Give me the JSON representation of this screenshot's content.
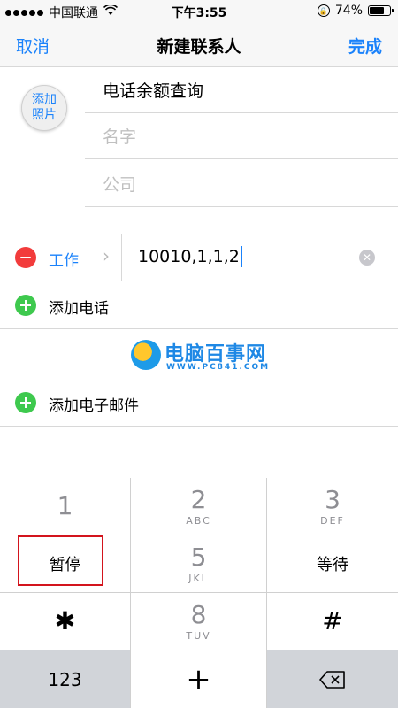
{
  "status_bar": {
    "carrier": "中国联通",
    "time": "下午3:55",
    "battery_percent": "74%",
    "battery_level": 0.74
  },
  "nav": {
    "cancel": "取消",
    "title": "新建联系人",
    "done": "完成"
  },
  "avatar": {
    "line1": "添加",
    "line2": "照片"
  },
  "fields": {
    "first": "电话余额查询",
    "name_placeholder": "名字",
    "company_placeholder": "公司"
  },
  "phone": {
    "label": "工作",
    "value": "10010,1,1,2"
  },
  "add_phone": "添加电话",
  "add_email": "添加电子邮件",
  "watermark": {
    "text": "电脑百事网",
    "url": "WWW.PC841.COM"
  },
  "keypad": {
    "k1": "1",
    "k2": "2",
    "k2_sub": "ABC",
    "k3": "3",
    "k3_sub": "DEF",
    "pause": "暂停",
    "k5": "5",
    "k5_sub": "JKL",
    "wait": "等待",
    "star": "✱",
    "k8": "8",
    "k8_sub": "TUV",
    "hash": "#",
    "k123": "123",
    "plus": "+"
  },
  "colors": {
    "accent": "#1a82fb",
    "delete": "#f23c3c",
    "add": "#3ec94e",
    "highlight": "#d3141d"
  },
  "icons": {
    "wifi": "wifi-icon",
    "rotation_lock": "rotation-lock-icon",
    "clear": "clear-icon",
    "delete": "backspace-icon"
  }
}
